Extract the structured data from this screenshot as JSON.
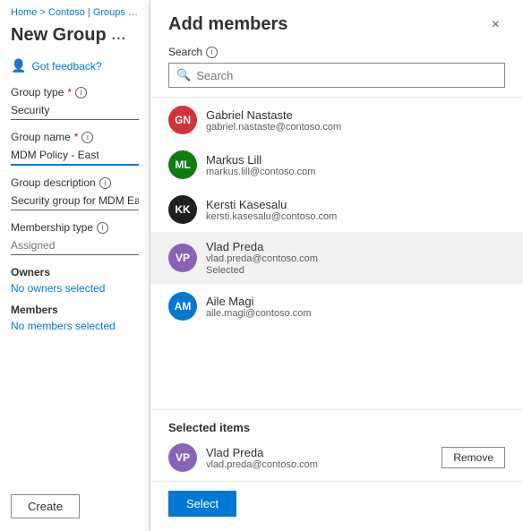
{
  "breadcrumb": {
    "text": "Home > Contoso | Groups > Gr"
  },
  "leftPanel": {
    "pageTitle": "New Group",
    "ellipsis": "...",
    "feedback": "Got feedback?",
    "fields": {
      "groupType": {
        "label": "Group type",
        "required": true,
        "value": "Security"
      },
      "groupName": {
        "label": "Group name",
        "required": true,
        "value": "MDM Policy - East"
      },
      "groupDescription": {
        "label": "Group description",
        "value": "Security group for MDM East"
      },
      "membershipType": {
        "label": "Membership type",
        "placeholder": "Assigned"
      }
    },
    "owners": {
      "label": "Owners",
      "linkText": "No owners selected"
    },
    "members": {
      "label": "Members",
      "linkText": "No members selected"
    },
    "createButton": "Create"
  },
  "modal": {
    "title": "Add members",
    "closeIcon": "×",
    "search": {
      "label": "Search",
      "placeholder": "Search"
    },
    "members": [
      {
        "id": 1,
        "initials": "GN",
        "avatarColor": "#d13438",
        "name": "Gabriel Nastaste",
        "email": "gabriel.nastaste@contoso.com",
        "selected": false
      },
      {
        "id": 2,
        "initials": "ML",
        "avatarColor": "#107c10",
        "name": "Markus Lill",
        "email": "markus.lill@contoso.com",
        "selected": false
      },
      {
        "id": 3,
        "initials": "KK",
        "avatarColor": "#201f1e",
        "name": "Kersti Kasesalu",
        "email": "kersti.kasesalu@contoso.com",
        "selected": false
      },
      {
        "id": 4,
        "initials": "VP",
        "avatarColor": "#8764b8",
        "name": "Vlad Preda",
        "email": "vlad.preda@contoso.com",
        "selected": true,
        "selectedTag": "Selected"
      },
      {
        "id": 5,
        "initials": "AM",
        "avatarColor": "#0078d4",
        "name": "Aile Magi",
        "email": "aile.magi@contoso.com",
        "selected": false
      }
    ],
    "selectedSection": {
      "title": "Selected items",
      "selectedMember": {
        "initials": "VP",
        "avatarColor": "#8764b8",
        "name": "Vlad Preda",
        "email": "vlad.preda@contoso.com"
      },
      "removeLabel": "Remove"
    },
    "selectButton": "Select"
  }
}
